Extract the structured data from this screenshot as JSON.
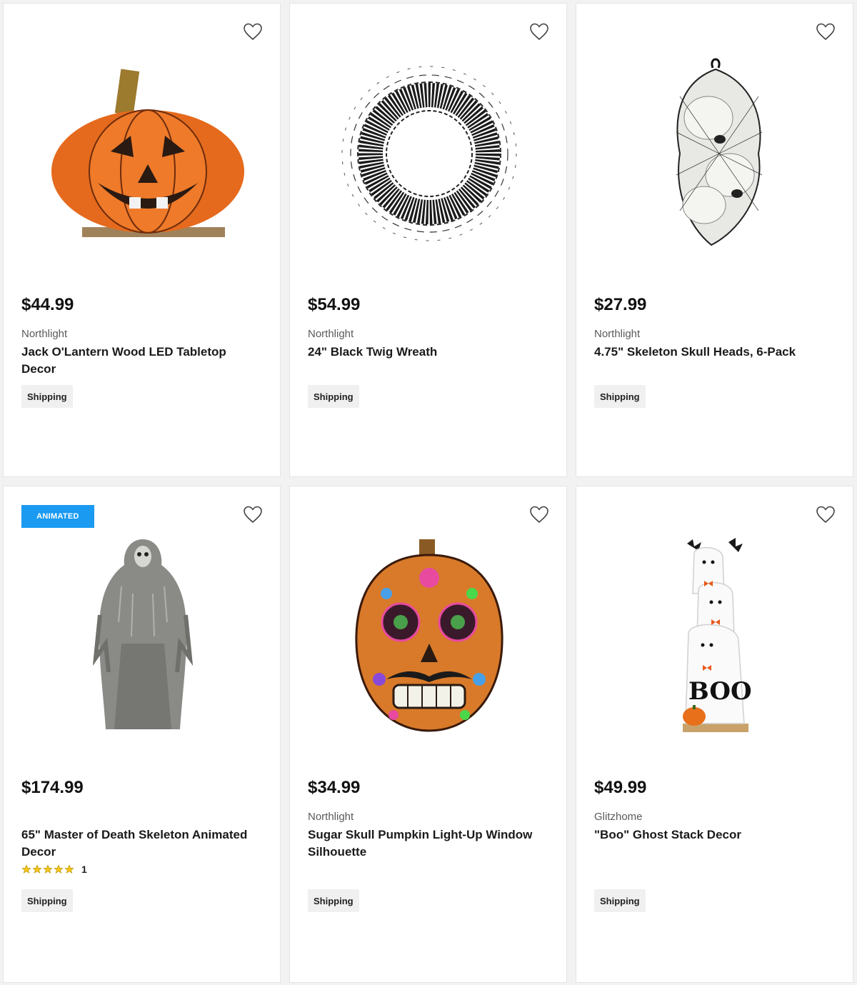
{
  "products": [
    {
      "price": "$44.99",
      "brand": "Northlight",
      "title": "Jack O'Lantern Wood LED Tabletop Decor",
      "shipping": "Shipping",
      "image_icon": "jack-o-lantern-image"
    },
    {
      "price": "$54.99",
      "brand": "Northlight",
      "title": "24\" Black Twig Wreath",
      "shipping": "Shipping",
      "image_icon": "twig-wreath-image"
    },
    {
      "price": "$27.99",
      "brand": "Northlight",
      "title": "4.75\" Skeleton Skull Heads, 6-Pack",
      "shipping": "Shipping",
      "image_icon": "skull-heads-image"
    },
    {
      "badge": "ANIMATED",
      "price": "$174.99",
      "brand": "",
      "title": "65\" Master of Death Skeleton Animated Decor",
      "rating_stars": 5,
      "rating_count": "1",
      "shipping": "Shipping",
      "image_icon": "grim-reaper-image"
    },
    {
      "price": "$34.99",
      "brand": "Northlight",
      "title": "Sugar Skull Pumpkin Light-Up Window Silhouette",
      "shipping": "Shipping",
      "image_icon": "sugar-skull-pumpkin-image"
    },
    {
      "price": "$49.99",
      "brand": "Glitzhome",
      "title": "\"Boo\" Ghost Stack Decor",
      "shipping": "Shipping",
      "image_icon": "ghost-stack-image"
    }
  ],
  "colors": {
    "badge": "#1a9af0",
    "star": "#f5c518",
    "shipping_bg": "#f0f0f0"
  }
}
